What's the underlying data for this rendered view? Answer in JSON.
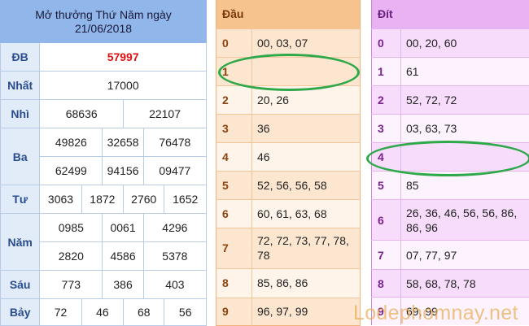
{
  "results": {
    "title_line1": "Mở thưởng Thứ Năm ngày",
    "title_line2": "21/06/2018",
    "db": {
      "label": "ĐB",
      "values": [
        "57997"
      ]
    },
    "nhat": {
      "label": "Nhất",
      "values": [
        "17000"
      ]
    },
    "nhi": {
      "label": "Nhì",
      "values": [
        "68636",
        "22107"
      ]
    },
    "ba": {
      "label": "Ba",
      "row1": [
        "49826",
        "32658",
        "76478"
      ],
      "row2": [
        "62499",
        "94156",
        "09477"
      ]
    },
    "tu": {
      "label": "Tư",
      "values": [
        "3063",
        "1872",
        "2760",
        "1652"
      ]
    },
    "nam": {
      "label": "Năm",
      "row1": [
        "0985",
        "0061",
        "4296"
      ],
      "row2": [
        "2820",
        "4586",
        "5378"
      ]
    },
    "sau": {
      "label": "Sáu",
      "values": [
        "773",
        "386",
        "403"
      ]
    },
    "bay": {
      "label": "Bảy",
      "values": [
        "72",
        "46",
        "68",
        "56"
      ]
    }
  },
  "dau": {
    "header": "Đầu",
    "rows": [
      {
        "num": "0",
        "values": "00, 03, 07"
      },
      {
        "num": "1",
        "values": ""
      },
      {
        "num": "2",
        "values": "20, 26"
      },
      {
        "num": "3",
        "values": "36"
      },
      {
        "num": "4",
        "values": "46"
      },
      {
        "num": "5",
        "values": "52, 56, 56, 58"
      },
      {
        "num": "6",
        "values": "60, 61, 63, 68"
      },
      {
        "num": "7",
        "values": "72, 72, 73, 77, 78, 78"
      },
      {
        "num": "8",
        "values": "85, 86, 86"
      },
      {
        "num": "9",
        "values": "96, 97, 99"
      }
    ]
  },
  "dit": {
    "header": "Đít",
    "rows": [
      {
        "num": "0",
        "values": "00, 20, 60"
      },
      {
        "num": "1",
        "values": "61"
      },
      {
        "num": "2",
        "values": "52, 72, 72"
      },
      {
        "num": "3",
        "values": "03, 63, 73"
      },
      {
        "num": "4",
        "values": ""
      },
      {
        "num": "5",
        "values": "85"
      },
      {
        "num": "6",
        "values": "26, 36, 46, 56, 56, 86, 86, 96"
      },
      {
        "num": "7",
        "values": "07, 77, 97"
      },
      {
        "num": "8",
        "values": "58, 68, 78, 78"
      },
      {
        "num": "9",
        "values": "69, 99"
      }
    ]
  },
  "watermark": "Lodephomnay.net",
  "colors": {
    "special_prize": "#dd1111",
    "circle": "#2fa84a",
    "watermark": "#e8ac50"
  }
}
